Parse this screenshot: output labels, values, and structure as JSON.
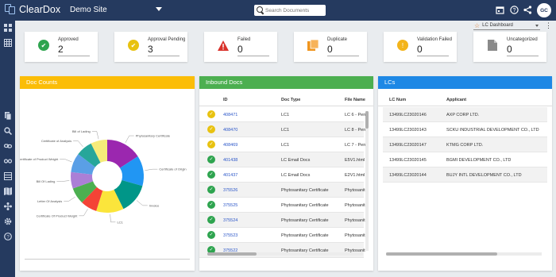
{
  "app": {
    "logo_text": "ClearDox",
    "site_name": "Demo Site",
    "avatar": "GC"
  },
  "search": {
    "placeholder": "Search Documents"
  },
  "top_icons": [
    "calendar-icon",
    "help-icon",
    "share-icon",
    "more-icon"
  ],
  "sidebar": [
    "dashboard-icon",
    "grid-icon",
    "documents-icon",
    "search-icon",
    "link-icon",
    "workflow-icon",
    "table-icon",
    "map-icon",
    "network-icon",
    "settings-icon",
    "help-icon"
  ],
  "dashboard_selector": {
    "value": "LC Dashboard"
  },
  "stats": [
    {
      "label": "Approved",
      "value": "2",
      "icon": "check-circle-icon",
      "color": "#2ea44f"
    },
    {
      "label": "Approval Pending",
      "value": "3",
      "icon": "check-circle-icon",
      "color": "#e8c210"
    },
    {
      "label": "Failed",
      "value": "0",
      "icon": "warning-triangle-icon",
      "color": "#d9322b"
    },
    {
      "label": "Duplicate",
      "value": "0",
      "icon": "copy-icon",
      "color": "#f0951e"
    },
    {
      "label": "Validation Failed",
      "value": "0",
      "icon": "alert-circle-icon",
      "color": "#f3b41b"
    },
    {
      "label": "Uncategorized",
      "value": "0",
      "icon": "file-icon",
      "color": "#8a8a8a"
    }
  ],
  "doc_counts": {
    "title": "Doc Counts",
    "header_color": "#fbbd08",
    "chart_data": {
      "type": "pie",
      "donut": true,
      "slices": [
        {
          "label": "Phytosanitary Certificate",
          "value": 13,
          "color": "#9b27af"
        },
        {
          "label": "Certificate of Origin",
          "value": 11,
          "color": "#2196f3"
        },
        {
          "label": "Invoice",
          "value": 11,
          "color": "#009688"
        },
        {
          "label": "LC1",
          "value": 10,
          "color": "#fbe53b"
        },
        {
          "label": "Certificate Of Product Weight",
          "value": 6,
          "color": "#f44336"
        },
        {
          "label": "Letter Of Analysis",
          "value": 6,
          "color": "#4caf50"
        },
        {
          "label": "Bill Of Lading",
          "value": 6,
          "color": "#ab7fd6"
        },
        {
          "label": "Certificate of Product Weight",
          "value": 7,
          "color": "#5a9fe6"
        },
        {
          "label": "Certificate of Analysis",
          "value": 6,
          "color": "#26a69a"
        },
        {
          "label": "Bill of Lading",
          "value": 6,
          "color": "#f5eb7a"
        }
      ]
    }
  },
  "inbound_docs": {
    "title": "Inbound Docs",
    "header_color": "#4caf50",
    "columns": [
      "ID",
      "Doc Type",
      "File Name"
    ],
    "rows": [
      {
        "status": "pending",
        "id": "408471",
        "doc_type": "LC1",
        "file": "LC 6 - Pend"
      },
      {
        "status": "pending",
        "id": "408470",
        "doc_type": "LC1",
        "file": "LC 8 - Pend"
      },
      {
        "status": "pending",
        "id": "408469",
        "doc_type": "LC1",
        "file": "LC 7 - Pend"
      },
      {
        "status": "approved",
        "id": "401438",
        "doc_type": "LC Email Docs",
        "file": "E5V1.html"
      },
      {
        "status": "approved",
        "id": "401437",
        "doc_type": "LC Email Docs",
        "file": "E2V1.html"
      },
      {
        "status": "approved",
        "id": "375526",
        "doc_type": "Phytosanitary Certificate",
        "file": "Phytosanit"
      },
      {
        "status": "approved",
        "id": "375525",
        "doc_type": "Phytosanitary Certificate",
        "file": "Phytosanit"
      },
      {
        "status": "approved",
        "id": "375524",
        "doc_type": "Phytosanitary Certificate",
        "file": "Phytosanit"
      },
      {
        "status": "approved",
        "id": "375523",
        "doc_type": "Phytosanitary Certificate",
        "file": "Phytosanit"
      },
      {
        "status": "approved",
        "id": "375522",
        "doc_type": "Phytosanitary Certificate",
        "file": "Phytosanit"
      }
    ]
  },
  "lcs": {
    "title": "LCs",
    "header_color": "#1e88e5",
    "columns": [
      "LC Num",
      "Applicant"
    ],
    "rows": [
      {
        "lc_num": "13499LC23020146",
        "applicant": "AXP CORP LTD."
      },
      {
        "lc_num": "13499LC23020143",
        "applicant": "SCKU INDUSTRIAL DEVELOPMENT CO., LTD"
      },
      {
        "lc_num": "13499LC23020147",
        "applicant": "KTMG CORP LTD."
      },
      {
        "lc_num": "13499LC23020145",
        "applicant": "BGMI DEVELOPMENT CO., LTD"
      },
      {
        "lc_num": "13499LC23020144",
        "applicant": "BUJY INTL DEVELOPMENT CO., LTD"
      }
    ]
  }
}
